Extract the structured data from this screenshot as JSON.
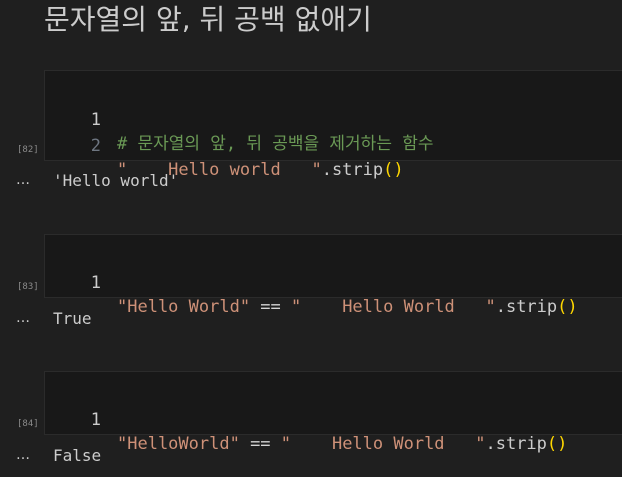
{
  "markdown": {
    "heading": "문자열의 앞, 뒤 공백 없애기"
  },
  "cells": [
    {
      "exec_count": "[82]",
      "lines": [
        {
          "number": "1",
          "tokens": [
            {
              "t": "comment",
              "v": "# 문자열의 앞, 뒤 공백을 제거하는 함수"
            }
          ]
        },
        {
          "number": "2",
          "tokens": [
            {
              "t": "string",
              "v": "\"    Hello world   \""
            },
            {
              "t": "text",
              "v": ".strip"
            },
            {
              "t": "bracket",
              "v": "()"
            }
          ]
        }
      ],
      "output": "'Hello world'"
    },
    {
      "exec_count": "[83]",
      "lines": [
        {
          "number": "1",
          "tokens": [
            {
              "t": "string",
              "v": "\"Hello World\""
            },
            {
              "t": "op",
              "v": " == "
            },
            {
              "t": "string",
              "v": "\"    Hello World   \""
            },
            {
              "t": "text",
              "v": ".strip"
            },
            {
              "t": "bracket",
              "v": "()"
            }
          ]
        }
      ],
      "output": "True"
    },
    {
      "exec_count": "[84]",
      "lines": [
        {
          "number": "1",
          "tokens": [
            {
              "t": "string",
              "v": "\"HelloWorld\""
            },
            {
              "t": "op",
              "v": " == "
            },
            {
              "t": "string",
              "v": "\"    Hello World   \""
            },
            {
              "t": "text",
              "v": ".strip"
            },
            {
              "t": "bracket",
              "v": "()"
            }
          ]
        }
      ],
      "output": "False"
    }
  ],
  "output_ellipsis": "…",
  "colors": {
    "background": "#1f1f1f",
    "editor_background": "#181818",
    "comment": "#6a9955",
    "string": "#ce9178",
    "bracket": "#ffd700",
    "text": "#cccccc"
  }
}
